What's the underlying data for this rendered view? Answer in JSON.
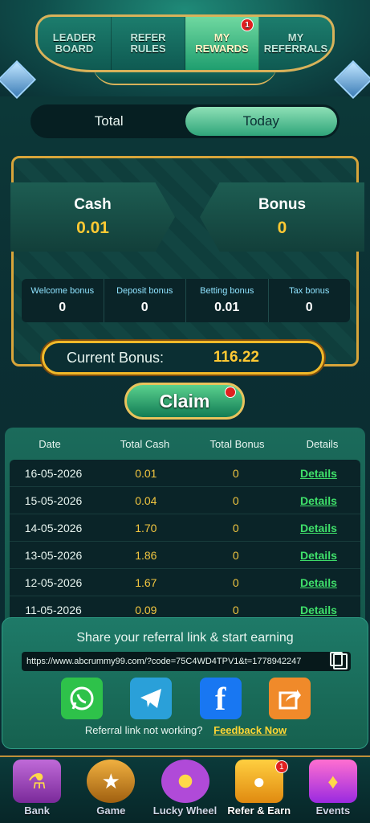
{
  "nav": {
    "tabs": [
      {
        "label": "LEADER\nBOARD"
      },
      {
        "label": "REFER\nRULES"
      },
      {
        "label": "MY\nREWARDS"
      },
      {
        "label": "MY\nREFERRALS"
      }
    ],
    "active_index": 2,
    "badge": "1"
  },
  "toggle": {
    "options": [
      "Total",
      "Today"
    ],
    "active": "Today"
  },
  "summary": {
    "cash_label": "Cash",
    "cash_value": "0.01",
    "bonus_label": "Bonus",
    "bonus_value": "0",
    "breakdown": [
      {
        "label": "Welcome bonus",
        "value": "0"
      },
      {
        "label": "Deposit bonus",
        "value": "0"
      },
      {
        "label": "Betting bonus",
        "value": "0.01"
      },
      {
        "label": "Tax bonus",
        "value": "0"
      }
    ],
    "current_bonus_label": "Current Bonus:",
    "current_bonus_value": "116.22"
  },
  "claim_label": "Claim",
  "table": {
    "headers": [
      "Date",
      "Total Cash",
      "Total Bonus",
      "Details"
    ],
    "rows": [
      {
        "date": "16-05-2026",
        "cash": "0.01",
        "bonus": "0",
        "details": "Details"
      },
      {
        "date": "15-05-2026",
        "cash": "0.04",
        "bonus": "0",
        "details": "Details"
      },
      {
        "date": "14-05-2026",
        "cash": "1.70",
        "bonus": "0",
        "details": "Details"
      },
      {
        "date": "13-05-2026",
        "cash": "1.86",
        "bonus": "0",
        "details": "Details"
      },
      {
        "date": "12-05-2026",
        "cash": "1.67",
        "bonus": "0",
        "details": "Details"
      },
      {
        "date": "11-05-2026",
        "cash": "0.09",
        "bonus": "0",
        "details": "Details"
      }
    ]
  },
  "share": {
    "title": "Share your referral link & start earning",
    "link": "https://www.abcrummy99.com/?code=75C4WD4TPV1&t=1778942247",
    "icons": [
      "whatsapp-icon",
      "telegram-icon",
      "facebook-icon",
      "share-icon"
    ],
    "footer_question": "Referral link not working?",
    "footer_link": "Feedback Now"
  },
  "bottom_nav": {
    "items": [
      {
        "label": "Bank"
      },
      {
        "label": "Game"
      },
      {
        "label": "Lucky Wheel"
      },
      {
        "label": "Refer & Earn"
      },
      {
        "label": "Events"
      }
    ],
    "active_index": 3,
    "badge": "1"
  },
  "colors": {
    "accent_gold": "#f0b929",
    "value_yellow": "#ffc933",
    "details_green": "#3fe06a",
    "background_teal": "#0b2f33"
  }
}
